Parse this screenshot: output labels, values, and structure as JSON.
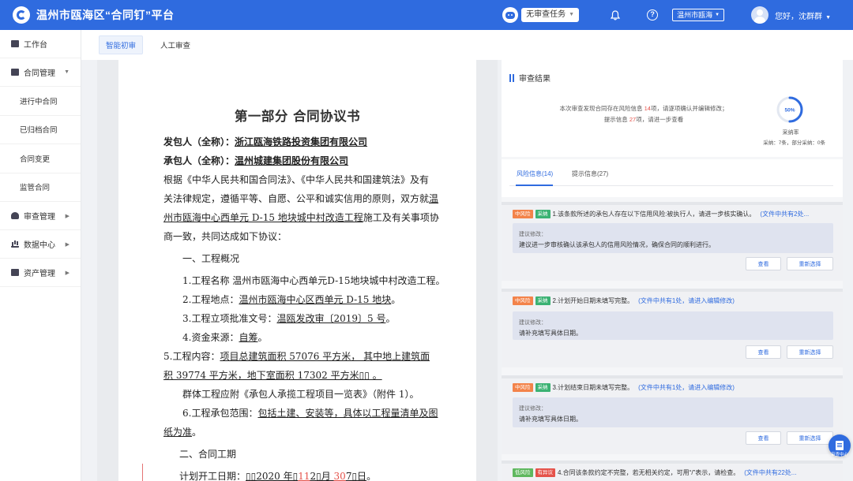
{
  "header": {
    "app_title": "温州市瓯海区“合同钉”平台",
    "task_select": "无审查任务",
    "region_select": "温州市瓯海",
    "greeting": "您好，沈群群"
  },
  "sidebar": {
    "items": [
      {
        "label": "工作台",
        "icon": "desktop-icon"
      },
      {
        "label": "合同管理",
        "icon": "folder-icon"
      },
      {
        "label": "进行中合同"
      },
      {
        "label": "已归档合同"
      },
      {
        "label": "合同变更"
      },
      {
        "label": "监管合同"
      },
      {
        "label": "审查管理",
        "icon": "user-icon"
      },
      {
        "label": "数据中心",
        "icon": "bar-chart-icon"
      },
      {
        "label": "资产管理",
        "icon": "asset-icon"
      }
    ]
  },
  "tabs": [
    "智能初审",
    "人工审查"
  ],
  "document": {
    "title": "第一部分 合同协议书",
    "employer_label": "发包人（全称）：",
    "employer_name": "浙江瓯海铁路投资集团有限公司",
    "contractor_label": "承包人（全称）：",
    "contractor_name": "温州城建集团股份有限公司",
    "para1_a": "根据《中华人民共和国合同法》、《中华人民共和国建筑法》及有",
    "para1_b1": "关法律规定，遵循平等、自愿、公平和诚实信用的原则，双方就",
    "para1_b2": "温",
    "para1_c1": "州市瓯海中心西单元 D-15 地块城中村改造工程",
    "para1_c2": "施工及有关事项协",
    "para1_d": "商一致，共同达成如下协议：",
    "sec1": "一、工程概况",
    "item1_label": "1.工程名称",
    "item1_value": "温州市瓯海中心西单元D-15地块城中村改造工程。",
    "item2_label": "2.工程地点：",
    "item2_value": "温州市瓯海中心区西单元 D-15 地块",
    "item2_end": "。",
    "item3_label": "3.工程立项批准文号：",
    "item3_value": "温瓯发改审〔2019〕5 号",
    "item3_end": "。",
    "item4_label": "4.资金来源：",
    "item4_value": "自筹",
    "item4_end": "。",
    "item5_label": "5.工程内容：",
    "item5_value_a": "项目总建筑面积  57076  平方米，  其中地上建筑面",
    "item5_value_b": "积 39774 平方米，地下室面积 17302 平方米▯▯  。",
    "group_line": "群体工程应附《承包人承揽工程项目一览表》（附件 1）。",
    "item6_label": "6.工程承包范围：",
    "item6_value_a": "包括土建、安装等，具体以工程量清单及图",
    "item6_value_b": "纸为准",
    "item6_end": "。",
    "sec2": "二、合同工期",
    "start_label": "计划开工日期：",
    "start_a": "▯▯2020 年▯",
    "start_b": "11",
    "start_c": "2",
    "start_d": "▯月 ",
    "start_e": "30",
    "start_f": "7",
    "start_g": "▯日",
    "start_end": "。"
  },
  "review": {
    "title": "审查结果",
    "summary_a": "本次审查发现合同存在风险信息 ",
    "risk_count": "14",
    "summary_b": "项，请逐项确认并编辑修改；",
    "summary_c": "提示信息 ",
    "hint_count": "27",
    "summary_d": "项，请进一步查看",
    "adoption_percent": "50%",
    "adoption_value": 0.5,
    "adoption_label": "采纳率",
    "adoption_stats": "采纳：7条，部分采纳：0条",
    "tab_risk": "风险信息(14)",
    "tab_hint": "提示信息(27)",
    "suggest_label": "建议修改：",
    "btn_view": "查看",
    "btn_reselect": "重新选择",
    "items": [
      {
        "level": "中风险",
        "status": "采纳",
        "text": "1.该条款所述的承包人存在以下信用风险:被执行人，请进一步核实确认。",
        "link": "(文件中共有2处...",
        "suggestion": "建议进一步审核确认该承包人的信用风险情况，确保合同的顺利进行。"
      },
      {
        "level": "中风险",
        "status": "采纳",
        "text": "2.计划开始日期未填写完整。",
        "link": "(文件中共有1处，请进入编辑修改)",
        "suggestion": "请补充填写具体日期。"
      },
      {
        "level": "中风险",
        "status": "采纳",
        "text": "3.计划结束日期未填写完整。",
        "link": "(文件中共有1处，请进入编辑修改)",
        "suggestion": "请补充填写具体日期。"
      },
      {
        "level": "低风险",
        "status": "有异议",
        "text": "4.合同该条款约定不完整，若无相关约定，可用“/”表示，请检查。",
        "link": "(文件中共有22处..."
      }
    ]
  },
  "float_button": {
    "label": "审查中心"
  },
  "colors": {
    "primary": "#2f6bdf",
    "risk_medium": "#f3834a",
    "risk_low": "#5fb85f",
    "adopted": "#3bb273",
    "dispute": "#e5534b"
  }
}
